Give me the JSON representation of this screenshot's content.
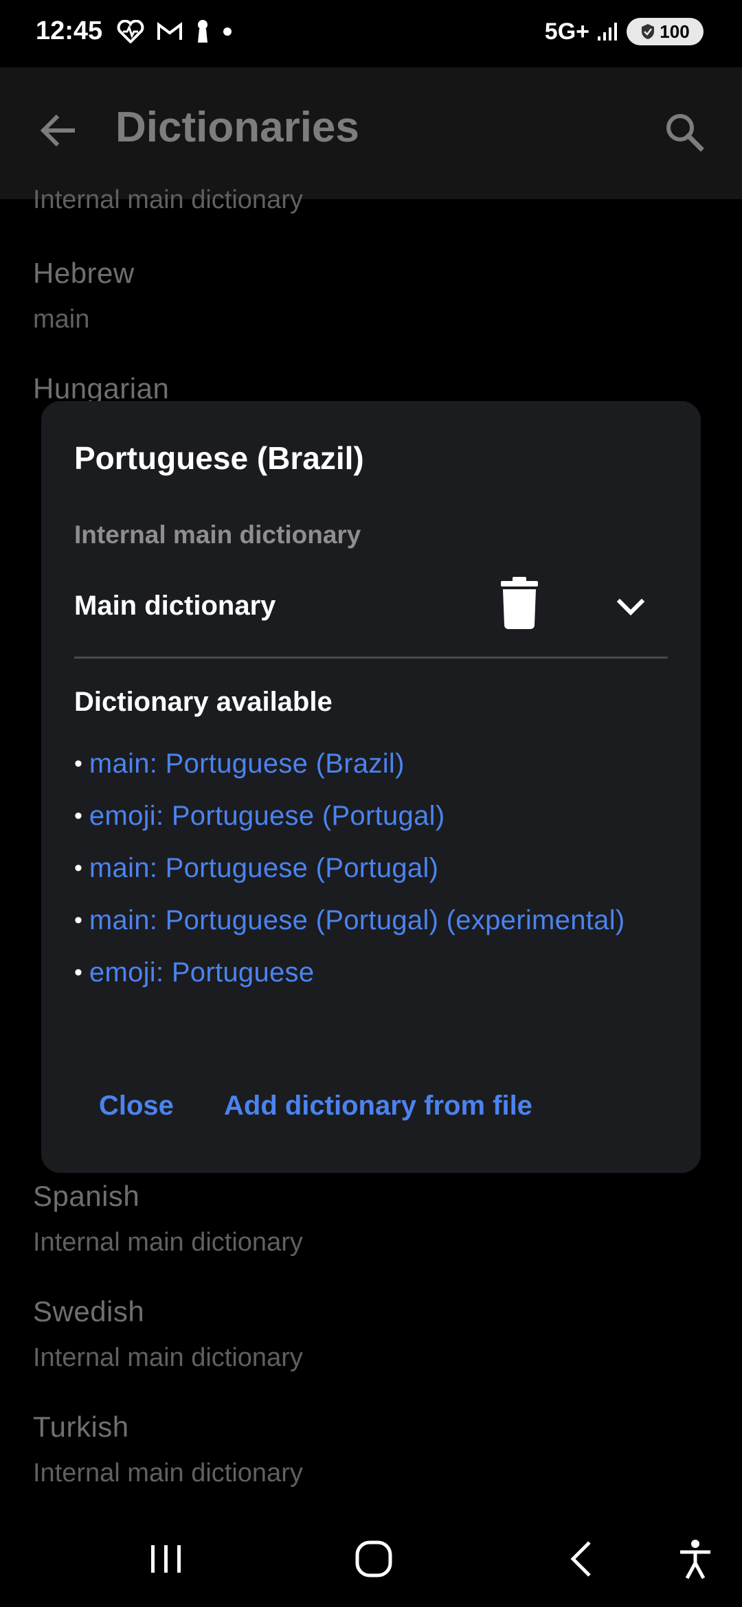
{
  "status_bar": {
    "time": "12:45",
    "network": "5G+",
    "battery": "100"
  },
  "app_bar": {
    "title": "Dictionaries"
  },
  "background_list": {
    "top_partial_sub": "Internal main dictionary",
    "items": [
      {
        "title": "Hebrew",
        "sub": "main"
      },
      {
        "title": "Hungarian",
        "sub": ""
      },
      {
        "title": "Spanish",
        "sub": "Internal main dictionary"
      },
      {
        "title": "Swedish",
        "sub": "Internal main dictionary"
      },
      {
        "title": "Turkish",
        "sub": "Internal main dictionary"
      }
    ]
  },
  "dialog": {
    "title": "Portuguese (Brazil)",
    "section_label": "Internal main dictionary",
    "dictionary_name": "Main dictionary",
    "available_title": "Dictionary available",
    "available": [
      "main: Portuguese (Brazil)",
      "emoji: Portuguese (Portugal)",
      "main: Portuguese (Portugal)",
      "main: Portuguese (Portugal) (experimental)",
      "emoji: Portuguese"
    ],
    "close_label": "Close",
    "add_label": "Add dictionary from file"
  },
  "colors": {
    "accent": "#4b83f0",
    "dialog_bg": "#1b1c1f",
    "app_bar_bg": "#151515"
  }
}
